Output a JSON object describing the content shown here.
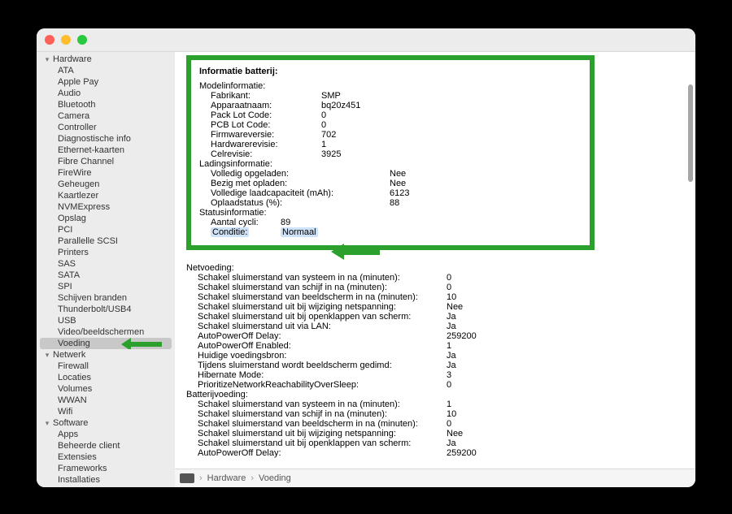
{
  "sidebar": {
    "hardware": {
      "label": "Hardware",
      "items": [
        "ATA",
        "Apple Pay",
        "Audio",
        "Bluetooth",
        "Camera",
        "Controller",
        "Diagnostische info",
        "Ethernet-kaarten",
        "Fibre Channel",
        "FireWire",
        "Geheugen",
        "Kaartlezer",
        "NVMExpress",
        "Opslag",
        "PCI",
        "Parallelle SCSI",
        "Printers",
        "SAS",
        "SATA",
        "SPI",
        "Schijven branden",
        "Thunderbolt/USB4",
        "USB",
        "Video/beeldschermen",
        "Voeding"
      ]
    },
    "network": {
      "label": "Netwerk",
      "items": [
        "Firewall",
        "Locaties",
        "Volumes",
        "WWAN",
        "Wifi"
      ]
    },
    "software": {
      "label": "Software",
      "items": [
        "Apps",
        "Beheerde client",
        "Extensies",
        "Frameworks",
        "Installaties"
      ]
    }
  },
  "battery": {
    "section_title": "Informatie batterij:",
    "model": {
      "title": "Modelinformatie:",
      "fabrikant_k": "Fabrikant:",
      "fabrikant_v": "SMP",
      "apparaat_k": "Apparaatnaam:",
      "apparaat_v": "bq20z451",
      "pack_k": "Pack Lot Code:",
      "pack_v": "0",
      "pcb_k": "PCB Lot Code:",
      "pcb_v": "0",
      "fw_k": "Firmwareversie:",
      "fw_v": "702",
      "hw_k": "Hardwarerevisie:",
      "hw_v": "1",
      "cel_k": "Celrevisie:",
      "cel_v": "3925"
    },
    "charge": {
      "title": "Ladingsinformatie:",
      "full_k": "Volledig opgeladen:",
      "full_v": "Nee",
      "charging_k": "Bezig met opladen:",
      "charging_v": "Nee",
      "cap_k": "Volledige laadcapaciteit (mAh):",
      "cap_v": "6123",
      "pct_k": "Oplaadstatus (%):",
      "pct_v": "88"
    },
    "status": {
      "title": "Statusinformatie:",
      "cycles_k": "Aantal cycli:",
      "cycles_v": "89",
      "cond_k": "Conditie:",
      "cond_v": "Normaal"
    }
  },
  "power": {
    "net_title": "Netvoeding:",
    "net": {
      "r1_k": "Schakel sluimerstand van systeem in na (minuten):",
      "r1_v": "0",
      "r2_k": "Schakel sluimerstand van schijf in na (minuten):",
      "r2_v": "0",
      "r3_k": "Schakel sluimerstand van beeldscherm in na (minuten):",
      "r3_v": "10",
      "r4_k": "Schakel sluimerstand uit bij wijziging netspanning:",
      "r4_v": "Nee",
      "r5_k": "Schakel sluimerstand uit bij openklappen van scherm:",
      "r5_v": "Ja",
      "r6_k": "Schakel sluimerstand uit via LAN:",
      "r6_v": "Ja",
      "r7_k": "AutoPowerOff Delay:",
      "r7_v": "259200",
      "r8_k": "AutoPowerOff Enabled:",
      "r8_v": "1",
      "r9_k": "Huidige voedingsbron:",
      "r9_v": "Ja",
      "r10_k": "Tijdens sluimerstand wordt beeldscherm gedimd:",
      "r10_v": "Ja",
      "r11_k": "Hibernate Mode:",
      "r11_v": "3",
      "r12_k": "PrioritizeNetworkReachabilityOverSleep:",
      "r12_v": "0"
    },
    "bat_title": "Batterijvoeding:",
    "bat": {
      "r1_k": "Schakel sluimerstand van systeem in na (minuten):",
      "r1_v": "1",
      "r2_k": "Schakel sluimerstand van schijf in na (minuten):",
      "r2_v": "10",
      "r3_k": "Schakel sluimerstand van beeldscherm in na (minuten):",
      "r3_v": "0",
      "r4_k": "Schakel sluimerstand uit bij wijziging netspanning:",
      "r4_v": "Nee",
      "r5_k": "Schakel sluimerstand uit bij openklappen van scherm:",
      "r5_v": "Ja",
      "r6_k": "AutoPowerOff Delay:",
      "r6_v": "259200"
    }
  },
  "breadcrumb": {
    "a": "Hardware",
    "b": "Voeding"
  }
}
